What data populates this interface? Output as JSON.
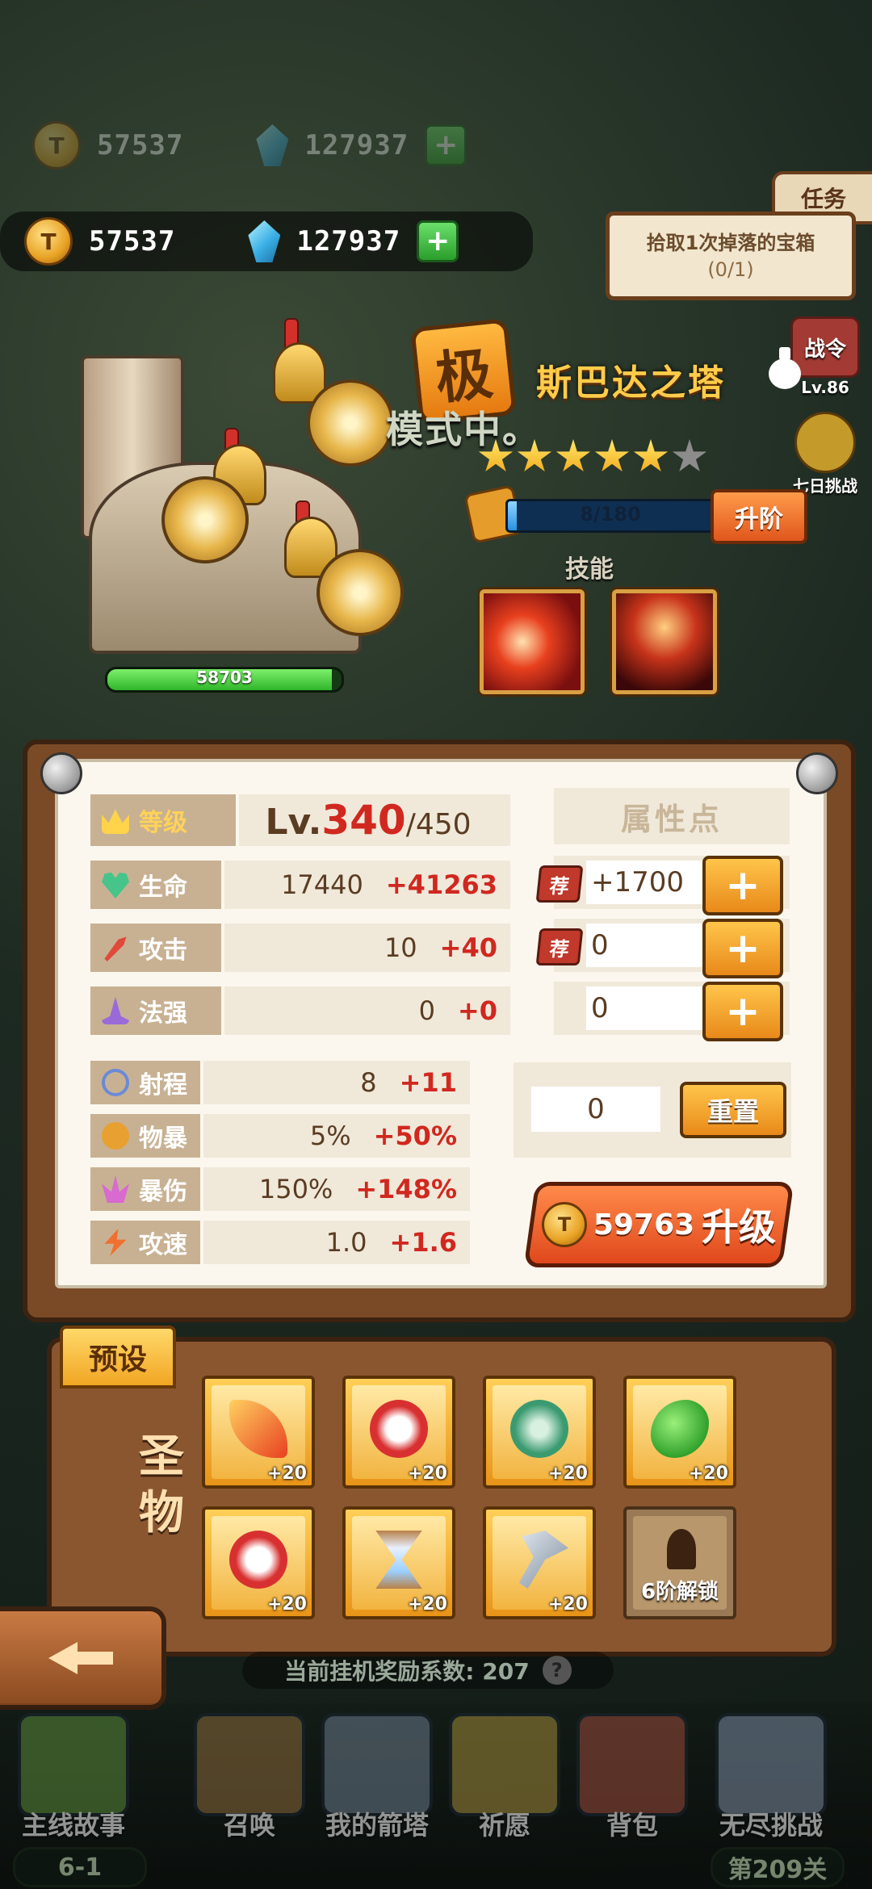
{
  "currency": {
    "gold": "57537",
    "gems": "127937",
    "gold_icon_glyph": "T"
  },
  "quest": {
    "tab_label": "任务",
    "title": "拾取1次掉落的宝箱",
    "progress": "(0/1)"
  },
  "side_buttons": {
    "battle_pass_label": "战令",
    "battle_pass_level": "Lv.86",
    "seven_day_label": "七日挑战"
  },
  "tower": {
    "hp": "58703",
    "hp_fill": 0.96,
    "mode_badge": "极",
    "mode_text": "模式中。",
    "name": "斯巴达之塔",
    "stars_on": 5,
    "stars_total": 6,
    "fragments": "8/180",
    "fragments_fill": 0.044,
    "ascend_label": "升阶",
    "skills_label": "技能"
  },
  "stats": {
    "level_label": "等级",
    "level_prefix": "Lv.",
    "level_current": "340",
    "level_max": "/450",
    "rows": [
      {
        "label": "生命",
        "base": "17440",
        "bonus": "+41263"
      },
      {
        "label": "攻击",
        "base": "10",
        "bonus": "+40"
      },
      {
        "label": "法强",
        "base": "0",
        "bonus": "+0"
      }
    ],
    "sub_rows": [
      {
        "label": "射程",
        "base": "8",
        "bonus": "+11"
      },
      {
        "label": "物暴",
        "base": "5%",
        "bonus": "+50%"
      },
      {
        "label": "暴伤",
        "base": "150%",
        "bonus": "+148%"
      },
      {
        "label": "攻速",
        "base": "1.0",
        "bonus": "+1.6"
      }
    ],
    "attr_points_label": "属性点",
    "recommend_tag": "荐",
    "attr_values": [
      "+1700",
      "0",
      "0"
    ],
    "plus_glyph": "+",
    "reset_value": "0",
    "reset_label": "重置",
    "upgrade_cost": "59763",
    "upgrade_label": "升级"
  },
  "relics": {
    "preset_label": "预设",
    "section_label_1": "圣",
    "section_label_2": "物",
    "slot_level": "+20",
    "locked_label": "6阶解锁"
  },
  "idle": {
    "text": "当前挂机奖励系数: 207",
    "help_glyph": "?"
  },
  "nav": {
    "items": [
      "主线故事",
      "召唤",
      "我的箭塔",
      "祈愿",
      "背包",
      "无尽挑战"
    ],
    "story_stage": "6-1",
    "endless_stage": "第209关"
  },
  "colors": {
    "bonus_red": "#d0281f",
    "gold": "#ffcc4a",
    "button_orange": "#e8891a"
  }
}
